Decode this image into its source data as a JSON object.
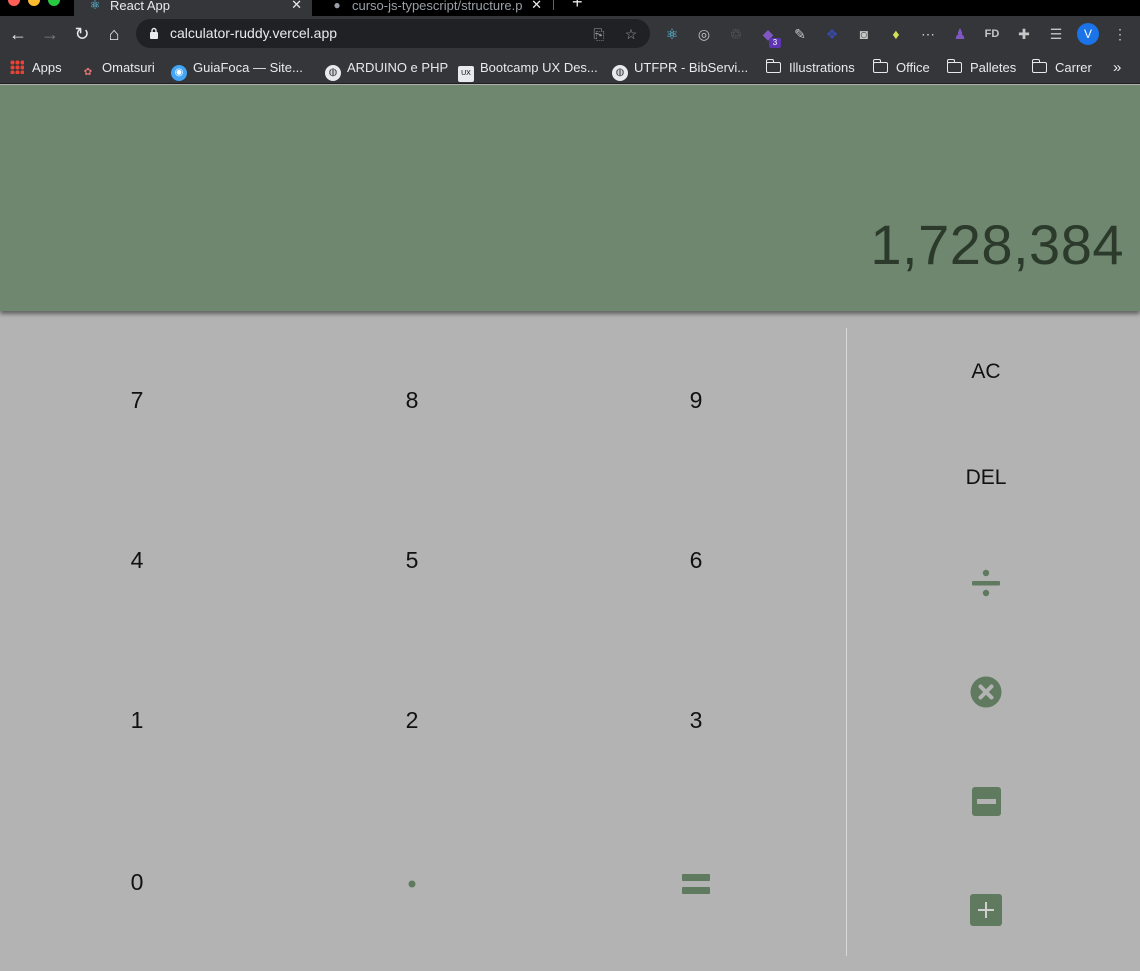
{
  "browser": {
    "tabs": [
      {
        "title": "React App",
        "icon": "react-icon",
        "active": true
      },
      {
        "title": "curso-js-typescript/structure.p",
        "icon": "github-icon",
        "active": false
      }
    ],
    "url": "calculator-ruddy.vercel.app",
    "profile_initial": "V",
    "extension_badge": "3",
    "bookmarks": [
      {
        "label": "Apps",
        "icon": "apps-grid-icon"
      },
      {
        "label": "Omatsuri",
        "icon": "omatsuri-icon"
      },
      {
        "label": "GuiaFoca — Site...",
        "icon": "guiafoca-icon"
      },
      {
        "label": "ARDUINO e PHP",
        "icon": "globe-icon"
      },
      {
        "label": "Bootcamp UX Des...",
        "icon": "uxbootcamp-icon"
      },
      {
        "label": "UTFPR - BibServi...",
        "icon": "globe-icon"
      },
      {
        "label": "Illustrations",
        "icon": "folder-icon"
      },
      {
        "label": "Office",
        "icon": "folder-icon"
      },
      {
        "label": "Palletes",
        "icon": "folder-icon"
      },
      {
        "label": "Carrer",
        "icon": "folder-icon"
      }
    ],
    "overflow_label": "»"
  },
  "calculator": {
    "display": "1,728,384",
    "digits": {
      "k7": "7",
      "k8": "8",
      "k9": "9",
      "k4": "4",
      "k5": "5",
      "k6": "6",
      "k1": "1",
      "k2": "2",
      "k3": "3",
      "k0": "0"
    },
    "ops": {
      "clear": "AC",
      "delete": "DEL"
    },
    "colors": {
      "display_bg": "#6f876f",
      "display_text": "#2b3a2b",
      "keypad_bg": "#b3b3b3",
      "accent": "#5f7a5f"
    }
  }
}
